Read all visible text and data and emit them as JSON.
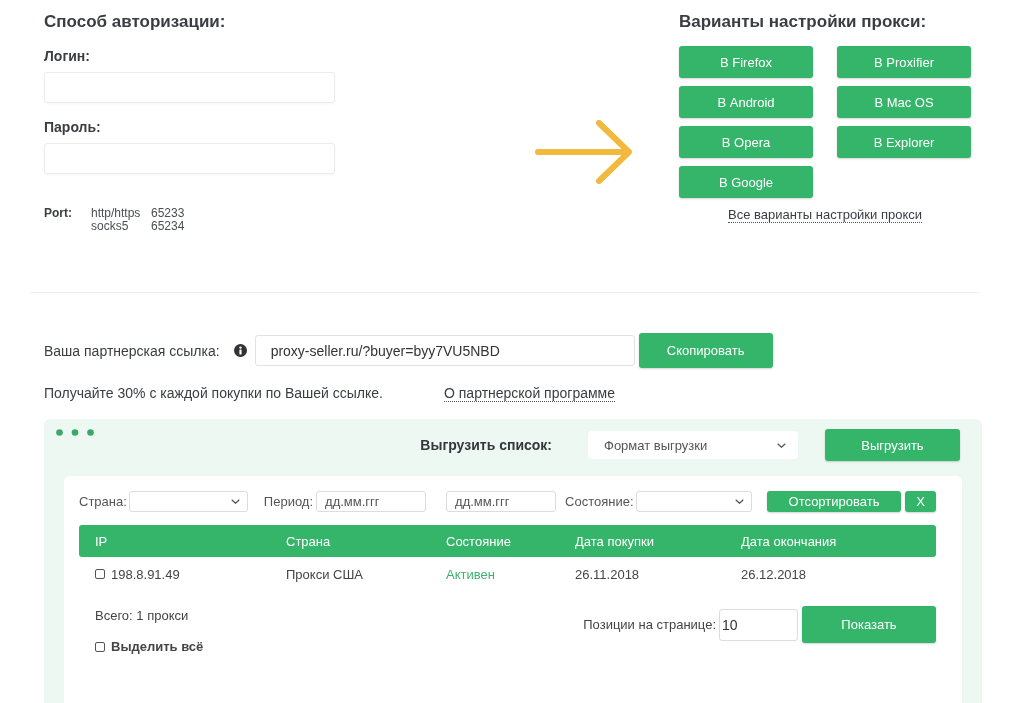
{
  "auth": {
    "title": "Способ авторизации:",
    "fields": [
      {
        "label": "Логин:"
      },
      {
        "label": "Пароль:"
      }
    ],
    "port": {
      "label": "Port:",
      "entries": [
        {
          "protocol": "http/https",
          "number": "65233"
        },
        {
          "protocol": "socks5",
          "number": "65234"
        }
      ]
    }
  },
  "setup": {
    "title": "Варианты настройки прокси:",
    "buttons": [
      "В Firefox",
      "В Proxifier",
      "В Android",
      "В Mac OS",
      "В Opera",
      "В Explorer",
      "В Google"
    ],
    "all_options_link": "Все варианты настройки прокси"
  },
  "partner": {
    "label": "Ваша партнерская ссылка:",
    "link_field": {
      "value": "proxy-seller.ru/?buyer=byy7VU5NBD"
    },
    "copy_button": "Скопировать",
    "note": "Получайте 30% с каждой покупки по Вашей ссылке.",
    "program_link": "О партнерской программе"
  },
  "proxy_list": {
    "export": {
      "label": "Выгрузить список:",
      "format_select": {
        "value": "Формат выгрузки"
      },
      "button": "Выгрузить"
    },
    "filters": {
      "country_label": "Страна:",
      "period_label": "Период:",
      "date_from": {
        "placeholder": "дд.мм.ггг"
      },
      "date_to": {
        "placeholder": "дд.мм.ггг"
      },
      "status_label": "Состояние:",
      "sort_button": "Отсортировать",
      "clear_button": "X"
    },
    "table": {
      "columns": [
        "IP",
        "Страна",
        "Состояние",
        "Дата покупки",
        "Дата окончания"
      ],
      "rows": [
        {
          "checked": false,
          "ip": "198.8.91.49",
          "country": "Прокси США",
          "status": {
            "text": "Активен",
            "color": "#3bb36c"
          },
          "purchase_date": "26.11.2018",
          "end_date": "26.12.2018"
        }
      ]
    },
    "total": "Всего: 1 прокси",
    "per_page": {
      "label": "Позиции на странице:",
      "value": "10"
    },
    "show_button": "Показать",
    "select_all": {
      "label": "Выделить всё",
      "checked": false
    }
  }
}
